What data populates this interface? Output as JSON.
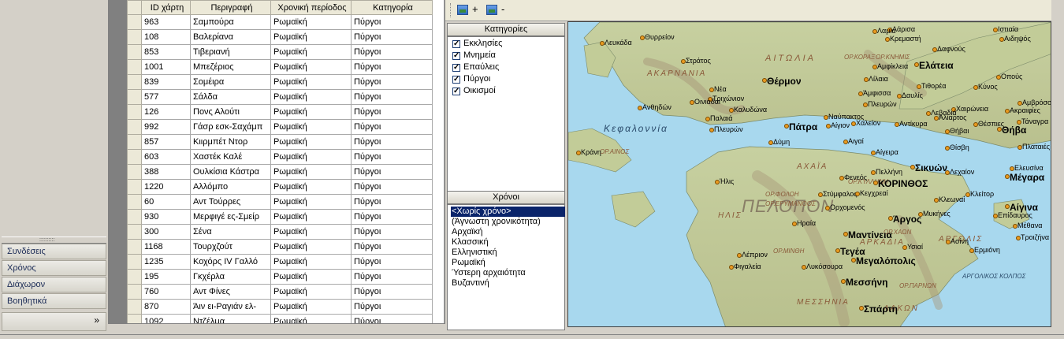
{
  "nav": {
    "items": [
      "Συνδέσεις",
      "Χρόνος",
      "Διάχωρον",
      "Βοηθητικά"
    ],
    "splitter_grip": "::::::::::",
    "more_glyph": "»"
  },
  "grid": {
    "columns": [
      "ID χάρτη",
      "Περιγραφή",
      "Χρονική περίοδος",
      "Κατηγορία"
    ],
    "rows": [
      [
        "963",
        "Σαμπούρα",
        "Ρωμαϊκή",
        "Πύργοι"
      ],
      [
        "108",
        "Βαλερίανα",
        "Ρωμαϊκή",
        "Πύργοι"
      ],
      [
        "853",
        "Τιβεριανή",
        "Ρωμαϊκή",
        "Πύργοι"
      ],
      [
        "1001",
        "Μπεζέριος",
        "Ρωμαϊκή",
        "Πύργοι"
      ],
      [
        "839",
        "Σομέιρα",
        "Ρωμαϊκή",
        "Πύργοι"
      ],
      [
        "577",
        "Σάλδα",
        "Ρωμαϊκή",
        "Πύργοι"
      ],
      [
        "126",
        "Πονς Αλούτι",
        "Ρωμαϊκή",
        "Πύργοι"
      ],
      [
        "992",
        "Γάσρ εσκ-Σαχάμπ",
        "Ρωμαϊκή",
        "Πύργοι"
      ],
      [
        "857",
        "Κιιρμπέτ Ντορ",
        "Ρωμαϊκή",
        "Πύργοι"
      ],
      [
        "603",
        "Χαστέκ Καλέ",
        "Ρωμαϊκή",
        "Πύργοι"
      ],
      [
        "388",
        "Ουλκίσια Κάστρα",
        "Ρωμαϊκή",
        "Πύργοι"
      ],
      [
        "1220",
        "Αλλόμπο",
        "Ρωμαϊκή",
        "Πύργοι"
      ],
      [
        "60",
        "Αντ Τούρρες",
        "Ρωμαϊκή",
        "Πύργοι"
      ],
      [
        "930",
        "Μερφιγέ ες-Σμείρ",
        "Ρωμαϊκή",
        "Πύργοι"
      ],
      [
        "300",
        "Σένα",
        "Ρωμαϊκή",
        "Πύργοι"
      ],
      [
        "1168",
        "Τουρχζούτ",
        "Ρωμαϊκή",
        "Πύργοι"
      ],
      [
        "1235",
        "Κοχόρς IV Γαλλό",
        "Ρωμαϊκή",
        "Πύργοι"
      ],
      [
        "195",
        "Γκχέρλα",
        "Ρωμαϊκή",
        "Πύργοι"
      ],
      [
        "760",
        "Αντ Φίνες",
        "Ρωμαϊκή",
        "Πύργοι"
      ],
      [
        "870",
        "Άιν ει-Ραγιάν ελ-",
        "Ρωμαϊκή",
        "Πύργοι"
      ],
      [
        "1092",
        "Ντζέλμα",
        "Ρωμαϊκή",
        "Πύργοι"
      ]
    ]
  },
  "toolbar": {
    "zoom_in": "+",
    "zoom_out": "-"
  },
  "categories": {
    "title": "Κατηγορίες",
    "items": [
      {
        "label": "Εκκλησίες",
        "checked": true
      },
      {
        "label": "Μνημεία",
        "checked": true
      },
      {
        "label": "Επαύλεις",
        "checked": true
      },
      {
        "label": "Πύργοι",
        "checked": true
      },
      {
        "label": "Οικισμοί",
        "checked": true
      }
    ]
  },
  "years": {
    "title": "Χρόνοι",
    "items": [
      "<Χωρίς χρόνο>",
      "(Άγνωστη χρονικότητα)",
      "Αρχαϊκή",
      "Κλασσική",
      "Ελληνιστική",
      "Ρωμαϊκή",
      "Ύστερη αρχαιότητα",
      "Βυζαντινή"
    ],
    "selected_index": 0
  },
  "map": {
    "colors": {
      "sea": "#a8d8ee",
      "land": "#c9d4a0",
      "mountain": "#b8a888",
      "site": "#e89a20"
    },
    "regions": [
      "ΑΙΤΩΛΙΑ",
      "ΑΚΑΡΝΑΝΙΑ",
      "ΠΕΛΟΠΟΝ",
      "ΑΧΑΪΑ",
      "ΗΛΙΣ",
      "ΑΡΚΑΔΙΑ",
      "ΑΡΓΟΛΙΣ",
      "ΜΕΣΣΗΝΙΑ",
      "ΛΑΚΩΝ",
      "ΑΡΓΟΛΙΚΟΣ ΚΟΛΠΟΣ"
    ],
    "seas": [
      "Κεφαλοννία"
    ],
    "mountains": [
      "ΟΡ.ΚΟΡΑΞ",
      "ΟΡ.ΚΝΗΜΙΣ",
      "ΟΡ.ΑΙΝΟΣ",
      "ΟΡ.ΦΟΛΟΗ",
      "ΟΡ.ΕΡΥΜΑΝΘΟΣ",
      "ΟΡ.ΚΥΛΛΗΝΗ",
      "ΟΡ.ΧΑΩΝ",
      "ΟΡ.ΜΙΝΘΗ",
      "ΟΡ.ΠΑΡΝΩΝ"
    ],
    "cities": [
      "Λάρισα",
      "Ιστιαία",
      "Λαμία",
      "Κρεμαστή",
      "Αιδηψός",
      "Θυρρείον",
      "Λευκάδα",
      "Δαφνούς",
      "Στράτος",
      "Ελάτεια",
      "Αμφίκλεια",
      "Θέρμον",
      "Οπούς",
      "Νέα",
      "Λίλαια",
      "Τιθορέα",
      "Άμφισσα",
      "Κύνος",
      "Τριχώνιον",
      "Δαυλίς",
      "Ανθηδών",
      "Οινιάδαι",
      "Πλευρών",
      "Αμβρόσσος",
      "Ακραιφίες",
      "Καλυδώνα",
      "Χαιρώνεια",
      "Λεβαδιά",
      "Ναύπακτος",
      "Παλαιά",
      "Αλίαρτος",
      "Χαλείον",
      "Αντίκυρα",
      "Θέσπιες",
      "Τάναγρα",
      "Θήβαι",
      "Πλευρών",
      "Πάτρα",
      "Αίγιον",
      "Θίσβη",
      "Θήβα",
      "Πλαταιές",
      "Δύμη",
      "Αιγαί",
      "Αίγειρα",
      "Κράνη",
      "Πελλήνη",
      "Σικυών",
      "Ελευσίνα",
      "Φενεός",
      "Λεχαίον",
      "Μέγαρα",
      "Ήλις",
      "ΚΟΡΙΝΘΟΣ",
      "Κλείτορ",
      "Στύμφαλος",
      "Κεγχρεαί",
      "Κλεωναί",
      "Ορχομενός",
      "Μυκήνες",
      "Αίγινα",
      "Άργος",
      "Ηραία",
      "Επίδαυρος",
      "Μέθανα",
      "Μαντίνεια",
      "Τροιζήνα",
      "Ασίνη",
      "Τεγέα",
      "Ερμιόνη",
      "Υσιαί",
      "Λέπριον",
      "Μεγαλόπολις",
      "Φιγαλεία",
      "Λυκόσουρα",
      "Μεσσήνη",
      "Σπάρτη"
    ]
  }
}
